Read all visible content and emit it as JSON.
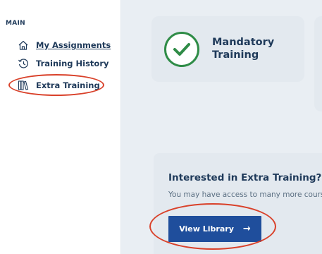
{
  "sidebar": {
    "section_label": "MAIN",
    "items": [
      {
        "label": "My Assignments",
        "icon": "home-icon"
      },
      {
        "label": "Training History",
        "icon": "history-icon"
      },
      {
        "label": "Extra Training",
        "icon": "library-icon"
      }
    ]
  },
  "cards": {
    "mandatory": {
      "title_line1": "Mandatory",
      "title_line2": "Training",
      "icon": "check-icon"
    }
  },
  "extra": {
    "title": "Interested in Extra Training?",
    "description": "You may have access to many more cours",
    "button_label": "View Library",
    "button_icon": "arrow-right-icon"
  },
  "colors": {
    "brand_blue": "#1f4e9c",
    "text_navy": "#1f3a5a",
    "check_green": "#2f8c47",
    "annotation_red": "#d9412a"
  }
}
